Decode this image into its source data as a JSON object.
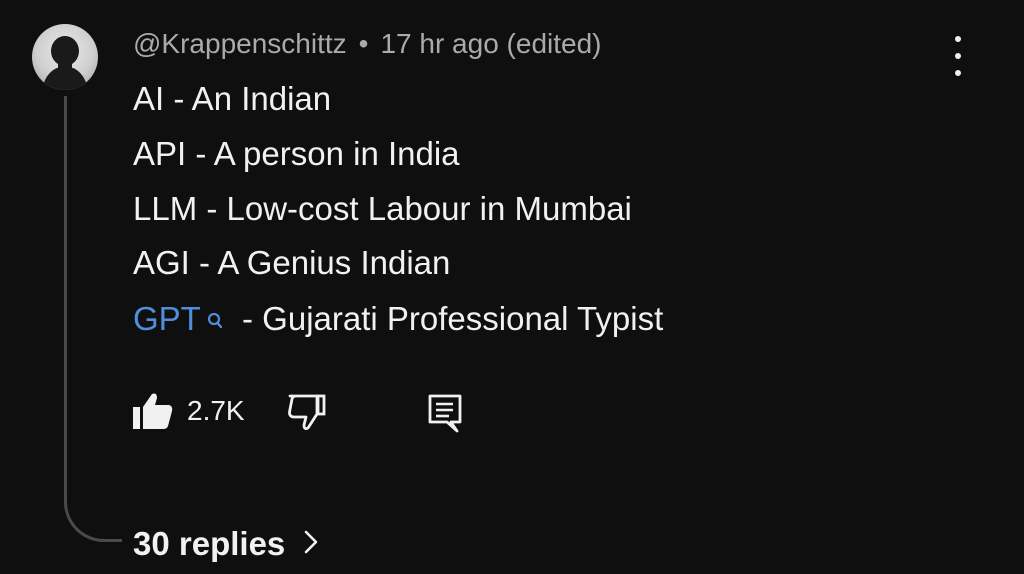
{
  "comment": {
    "author": "@Krappenschittz",
    "separator": "•",
    "time": "17 hr ago (edited)",
    "lines": [
      "AI - An Indian",
      "API - A person in India",
      "LLM - Low-cost Labour in Mumbai",
      "AGI - A Genius Indian"
    ],
    "last_line": {
      "link_text": "GPT",
      "rest": " - Gujarati Professional Typist",
      "link_color": "#4f8fd9"
    },
    "likes": "2.7K",
    "replies_label": "30 replies"
  },
  "icons": {
    "avatar": "avatar",
    "more": "more-vert-icon",
    "search": "search-icon",
    "like": "thumbs-up-filled-icon",
    "dislike": "thumbs-down-outline-icon",
    "reply": "comment-icon",
    "chevron": "chevron-right-icon"
  },
  "colors": {
    "background": "#0f0f0f",
    "text": "#f1f1f1",
    "meta_text": "#aaaaaa",
    "link": "#4f8fd9"
  }
}
